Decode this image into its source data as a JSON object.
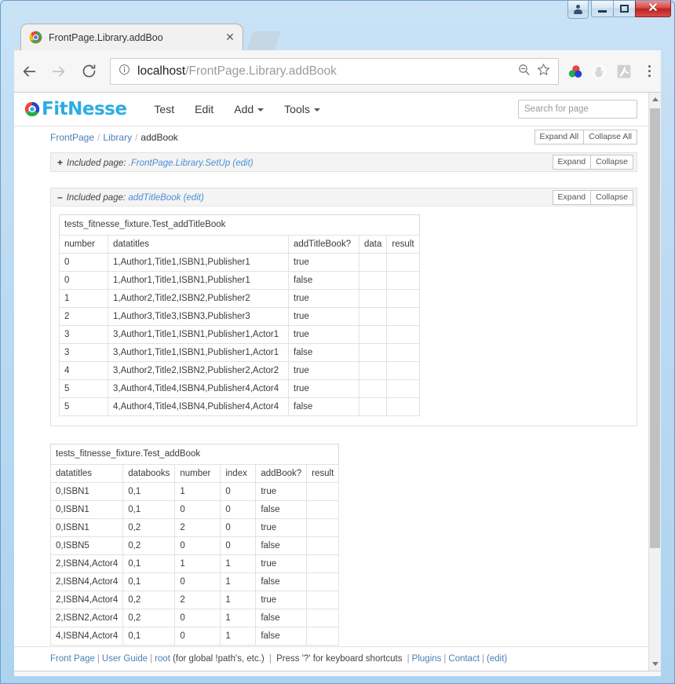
{
  "window": {
    "controls": {
      "user_account": "user-account",
      "minimize": "minimize",
      "maximize": "maximize",
      "close": "✕"
    }
  },
  "browser": {
    "tab": {
      "title": "FrontPage.Library.addBoo",
      "close_label": "✕",
      "favicon": "chrome-favicon"
    },
    "new_tab_label": "",
    "toolbar": {
      "back": "back-arrow",
      "forward": "forward-arrow",
      "reload": "reload",
      "site_info": "info-circle",
      "url_host": "localhost",
      "url_path": "/FrontPage.Library.addBook",
      "url_full": "localhost/FrontPage.Library.addBook",
      "zoom_out": "zoom-out",
      "bookmark": "star",
      "extensions": [
        "color-circles-extension",
        "hand-extension",
        "pdf-extension"
      ],
      "menu": "three-dot-menu"
    }
  },
  "page": {
    "header": {
      "logo_text": "FitNesse",
      "nav": [
        {
          "label": "Test",
          "has_caret": false
        },
        {
          "label": "Edit",
          "has_caret": false
        },
        {
          "label": "Add",
          "has_caret": true
        },
        {
          "label": "Tools",
          "has_caret": true
        }
      ],
      "search_placeholder": "Search for page"
    },
    "breadcrumb": {
      "items": [
        {
          "label": "FrontPage",
          "link": true
        },
        {
          "label": "Library",
          "link": true
        },
        {
          "label": "addBook",
          "link": false
        }
      ],
      "separator": "/",
      "expand_all": "Expand All",
      "collapse_all": "Collapse All"
    },
    "included_pages": [
      {
        "toggle": "+",
        "prefix": "Included page:",
        "link": ".FrontPage.Library.SetUp",
        "edit": "(edit)",
        "expand": "Expand",
        "collapse": "Collapse",
        "collapsed": true
      },
      {
        "toggle": "–",
        "prefix": "Included page:",
        "link": "addTitleBook",
        "edit": "(edit)",
        "expand": "Expand",
        "collapse": "Collapse",
        "collapsed": false
      }
    ],
    "tables": [
      {
        "name": "tests_fitnesse_fixture.Test_addTitleBook",
        "headers": [
          "number",
          "datatitles",
          "addTitleBook?",
          "data",
          "result"
        ],
        "rows": [
          [
            "0",
            "1,Author1,Title1,ISBN1,Publisher1",
            "true",
            "",
            ""
          ],
          [
            "0",
            "1,Author1,Title1,ISBN1,Publisher1",
            "false",
            "",
            ""
          ],
          [
            "1",
            "1,Author2,Title2,ISBN2,Publisher2",
            "true",
            "",
            ""
          ],
          [
            "2",
            "1,Author3,Title3,ISBN3,Publisher3",
            "true",
            "",
            ""
          ],
          [
            "3",
            "3,Author1,Title1,ISBN1,Publisher1,Actor1",
            "true",
            "",
            ""
          ],
          [
            "3",
            "3,Author1,Title1,ISBN1,Publisher1,Actor1",
            "false",
            "",
            ""
          ],
          [
            "4",
            "3,Author2,Title2,ISBN2,Publisher2,Actor2",
            "true",
            "",
            ""
          ],
          [
            "5",
            "3,Author4,Title4,ISBN4,Publisher4,Actor4",
            "true",
            "",
            ""
          ],
          [
            "5",
            "4,Author4,Title4,ISBN4,Publisher4,Actor4",
            "false",
            "",
            ""
          ]
        ]
      },
      {
        "name": "tests_fitnesse_fixture.Test_addBook",
        "headers": [
          "datatitles",
          "databooks",
          "number",
          "index",
          "addBook?",
          "result"
        ],
        "rows": [
          [
            "0,ISBN1",
            "0,1",
            "1",
            "0",
            "true",
            ""
          ],
          [
            "0,ISBN1",
            "0,1",
            "0",
            "0",
            "false",
            ""
          ],
          [
            "0,ISBN1",
            "0,2",
            "2",
            "0",
            "true",
            ""
          ],
          [
            "0,ISBN5",
            "0,2",
            "0",
            "0",
            "false",
            ""
          ],
          [
            "2,ISBN4,Actor4",
            "0,1",
            "1",
            "1",
            "true",
            ""
          ],
          [
            "2,ISBN4,Actor4",
            "0,1",
            "0",
            "1",
            "false",
            ""
          ],
          [
            "2,ISBN4,Actor4",
            "0,2",
            "2",
            "1",
            "true",
            ""
          ],
          [
            "2,ISBN2,Actor4",
            "0,2",
            "0",
            "1",
            "false",
            ""
          ],
          [
            "4,ISBN4,Actor4",
            "0,1",
            "0",
            "1",
            "false",
            ""
          ]
        ]
      }
    ],
    "footer": {
      "parts": [
        {
          "text": "Front Page",
          "link": true
        },
        {
          "text": "|",
          "link": false,
          "sep": true
        },
        {
          "text": "User Guide",
          "link": true
        },
        {
          "text": "|",
          "link": false,
          "sep": true
        },
        {
          "text": "root",
          "link": true
        },
        {
          "text": " (for global !path's, etc.) ",
          "link": false,
          "italicish": true
        },
        {
          "text": "|",
          "link": false,
          "sep": true
        },
        {
          "text": " Press '?' for keyboard shortcuts ",
          "link": false
        },
        {
          "text": "|",
          "link": false,
          "sep": true
        },
        {
          "text": "Plugins",
          "link": true
        },
        {
          "text": "|",
          "link": false,
          "sep": true
        },
        {
          "text": "Contact",
          "link": true
        },
        {
          "text": "|",
          "link": false,
          "sep": true
        },
        {
          "text": "(edit)",
          "link": true
        }
      ]
    }
  },
  "colors": {
    "logo_blue": "#2bade3",
    "link_blue": "#4b7fb5",
    "chrome_bg": "#f6f6f6",
    "win_frame": "#aed3ef",
    "close_red": "#bd2222"
  }
}
